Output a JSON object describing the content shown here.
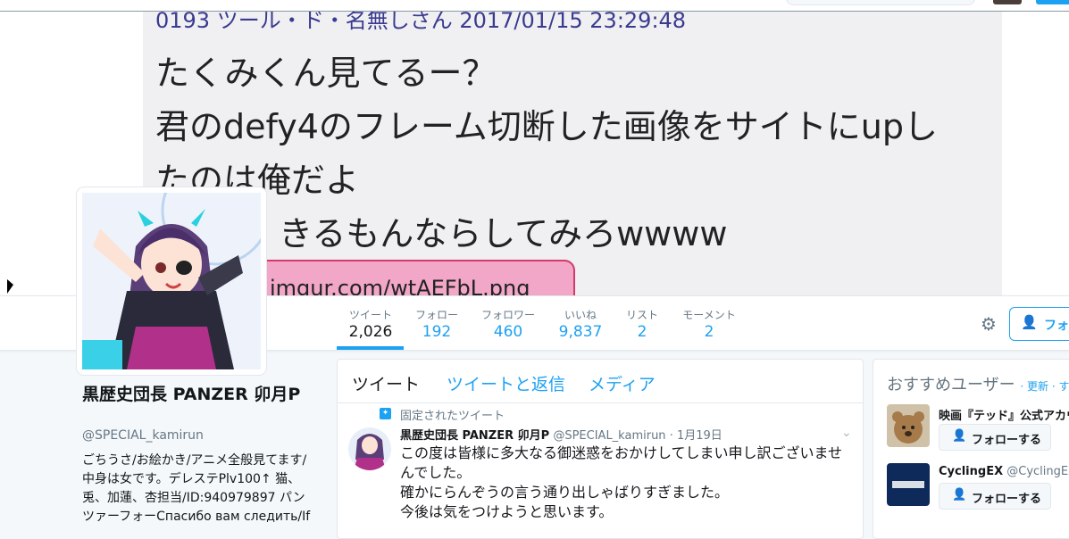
{
  "banner": {
    "meta": "0193 ツール・ド・名無しさん 2017/01/15 23:29:48",
    "lines": [
      "たくみくん見てるー？",
      "君のdefy4のフレーム切断した画像をサイトにupし",
      "たのは俺だよ",
      "きるもんならしてみろwwww"
    ],
    "link_text": "imgur.com/wtAEFbL.png"
  },
  "stats": [
    {
      "label": "ツイート",
      "value": "2,026"
    },
    {
      "label": "フォロー",
      "value": "192"
    },
    {
      "label": "フォロワー",
      "value": "460"
    },
    {
      "label": "いいね",
      "value": "9,837"
    },
    {
      "label": "リスト",
      "value": "2"
    },
    {
      "label": "モーメント",
      "value": "2"
    }
  ],
  "header": {
    "follow_label": "フォロ"
  },
  "profile": {
    "name": "黒歴史団長 PANZER 卯月P",
    "handle": "@SPECIAL_kamirun",
    "bio": "ごちうさ/お絵かき/アニメ全般見てます/中身は女です。デレステPlv100↑ 猫、兎、加蓮、杏担当/ID:940979897 パンツァーフォーСпасибо вам следить/If"
  },
  "timeline": {
    "tabs": [
      "ツイート",
      "ツイートと返信",
      "メディア"
    ],
    "pinned_label": "固定されたツイート",
    "tweet": {
      "name": "黒歴史団長 PANZER 卯月P",
      "handle": "@SPECIAL_kamirun",
      "time": "· 1月19日",
      "lines": [
        "この度は皆様に多大なる御迷惑をおかけしてしまい申し訳ございませ",
        "んでした。",
        "確かにらんぞうの言う通り出しゃばりすぎました。",
        "今後は気をつけようと思います。"
      ]
    }
  },
  "suggestions": {
    "title": "おすすめユーザー",
    "refresh": "· 更新 · すべ",
    "users": [
      {
        "name": "映画『テッド』公式アカウ",
        "handle": "",
        "button": "フォローする"
      },
      {
        "name": "CyclingEX",
        "handle": "@CyclingEX",
        "button": "フォローする"
      }
    ]
  },
  "colors": {
    "accent": "#1da1f2",
    "muted": "#657786",
    "border": "#e1e8ed"
  }
}
